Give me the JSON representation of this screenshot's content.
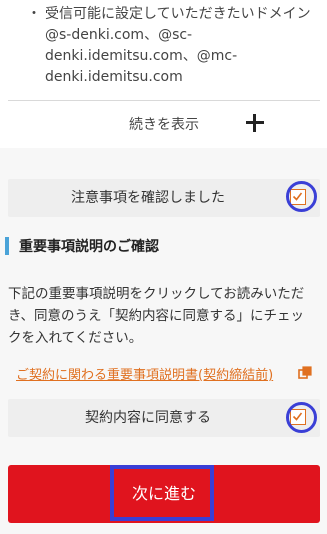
{
  "notice": {
    "bullet": "・",
    "lines": [
      "受信可能に設定していただきたいドメイン",
      "@s-denki.com、@sc-",
      "denki.idemitsu.com、@mc-",
      "denki.idemitsu.com"
    ],
    "show_more_label": "続きを表示"
  },
  "confirm_notes": {
    "label": "注意事項を確認しました",
    "checked": true
  },
  "section": {
    "title": "重要事項説明のご確認",
    "description": [
      "下記の重要事項説明をクリックしてお読みいただ",
      "き、同意のうえ「契約内容に同意する」にチェッ",
      "クを入れてください。"
    ],
    "link_label": "ご契約に関わる重要事項説明書(契約締結前)"
  },
  "confirm_contract": {
    "label": "契約内容に同意する",
    "checked": true
  },
  "next_button": {
    "label": "次に進む"
  },
  "colors": {
    "accent_orange": "#e07020",
    "button_red": "#e0141e",
    "highlight_blue": "#3a3fd6",
    "section_bar_blue": "#4aa3d8"
  }
}
